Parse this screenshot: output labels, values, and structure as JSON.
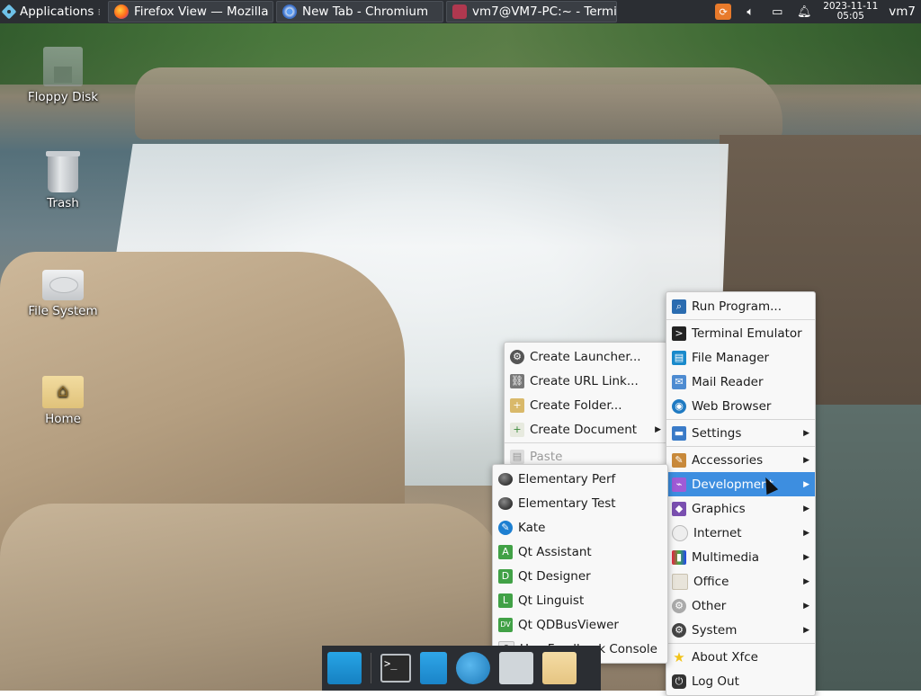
{
  "panel": {
    "applications_label": "Applications",
    "tasks": [
      {
        "label": "Firefox View — Mozilla F...",
        "icon": "firefox-icon"
      },
      {
        "label": "New Tab - Chromium",
        "icon": "chromium-icon"
      },
      {
        "label": "vm7@VM7-PC:~ - Termi...",
        "icon": "terminal-icon"
      }
    ],
    "clock_date": "2023-11-11",
    "clock_time": "05:05",
    "user": "vm7"
  },
  "desktop_icons": [
    {
      "label": "Floppy Disk"
    },
    {
      "label": "Trash"
    },
    {
      "label": "File System"
    },
    {
      "label": "Home"
    }
  ],
  "desktop_menu": {
    "items": [
      {
        "label": "Create Launcher...",
        "icon": "launcher-icon"
      },
      {
        "label": "Create URL Link...",
        "icon": "link-icon"
      },
      {
        "label": "Create Folder...",
        "icon": "folder-icon"
      },
      {
        "label": "Create Document",
        "icon": "document-icon",
        "submenu": true
      },
      {
        "label": "Paste",
        "icon": "paste-icon",
        "disabled": true
      }
    ]
  },
  "main_menu": {
    "items": [
      {
        "label": "Run Program...",
        "icon": "run-icon"
      },
      {
        "label": "Terminal Emulator",
        "icon": "terminal-icon"
      },
      {
        "label": "File Manager",
        "icon": "file-manager-icon"
      },
      {
        "label": "Mail Reader",
        "icon": "mail-icon"
      },
      {
        "label": "Web Browser",
        "icon": "globe-icon"
      },
      {
        "label": "Settings",
        "icon": "settings-icon",
        "submenu": true
      },
      {
        "label": "Accessories",
        "icon": "accessories-icon",
        "submenu": true
      },
      {
        "label": "Development",
        "icon": "development-icon",
        "submenu": true,
        "selected": true
      },
      {
        "label": "Graphics",
        "icon": "graphics-icon",
        "submenu": true
      },
      {
        "label": "Internet",
        "icon": "cloud-icon",
        "submenu": true
      },
      {
        "label": "Multimedia",
        "icon": "multimedia-icon",
        "submenu": true
      },
      {
        "label": "Office",
        "icon": "office-icon",
        "submenu": true
      },
      {
        "label": "Other",
        "icon": "other-icon",
        "submenu": true
      },
      {
        "label": "System",
        "icon": "system-icon",
        "submenu": true
      },
      {
        "label": "About Xfce",
        "icon": "star-icon"
      },
      {
        "label": "Log Out",
        "icon": "logout-icon"
      }
    ]
  },
  "dev_menu": {
    "items": [
      {
        "label": "Elementary Perf",
        "icon": "elementary-icon"
      },
      {
        "label": "Elementary Test",
        "icon": "elementary-icon"
      },
      {
        "label": "Kate",
        "icon": "kate-icon"
      },
      {
        "label": "Qt Assistant",
        "icon": "qt-assistant-icon",
        "badge": "A"
      },
      {
        "label": "Qt Designer",
        "icon": "qt-designer-icon",
        "badge": "D"
      },
      {
        "label": "Qt Linguist",
        "icon": "qt-linguist-icon",
        "badge": "L"
      },
      {
        "label": "Qt QDBusViewer",
        "icon": "qt-dbus-icon",
        "badge": "DV"
      },
      {
        "label": "UserFeedback Console",
        "icon": "feedback-icon",
        "badge": "?"
      }
    ]
  },
  "dock": {
    "items": [
      {
        "name": "show-desktop"
      },
      {
        "name": "terminal"
      },
      {
        "name": "file-manager"
      },
      {
        "name": "web-browser"
      },
      {
        "name": "app-finder"
      },
      {
        "name": "home-folder"
      }
    ]
  },
  "colors": {
    "panel_bg": "#2b2e33",
    "menu_bg": "#f8f8f8",
    "selection": "#3d8ee0"
  }
}
